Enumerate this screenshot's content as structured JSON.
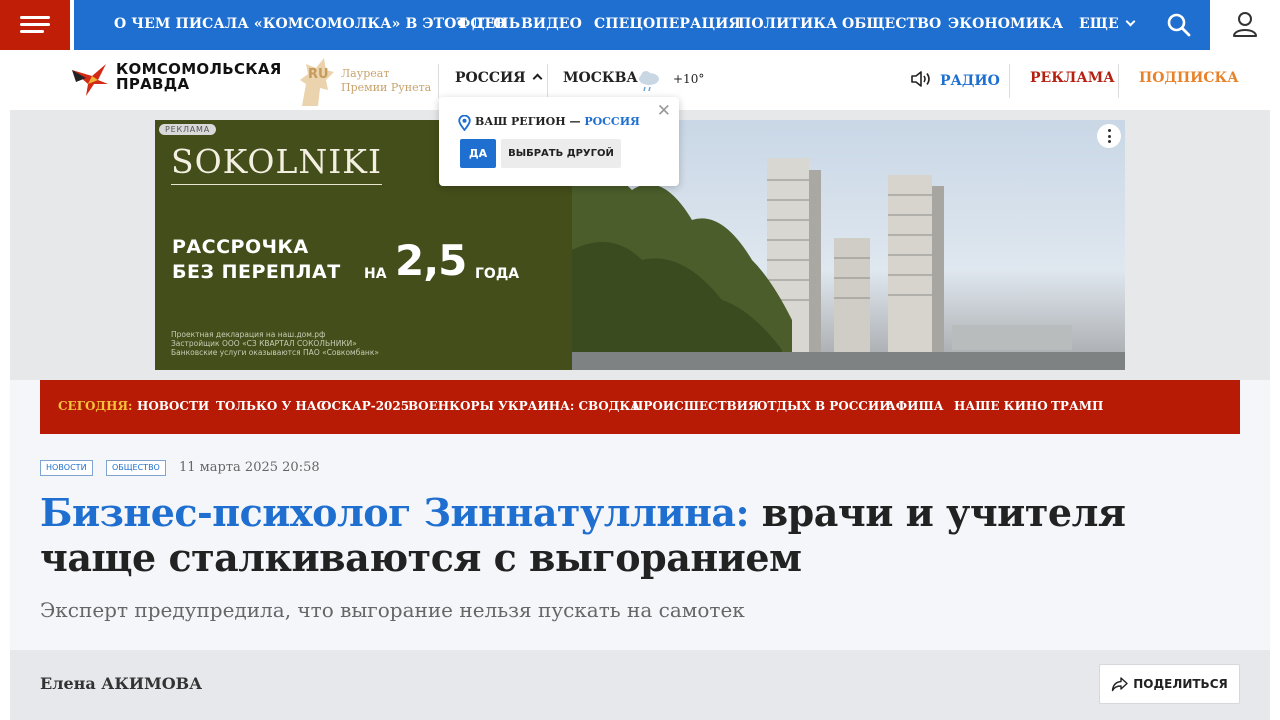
{
  "topnav": {
    "items": [
      "О ЧЕМ ПИСАЛА «КОМСОМОЛКА» В ЭТОТ ДЕНЬ",
      "ФОТО",
      "ВИДЕО",
      "СПЕЦОПЕРАЦИЯ",
      "ПОЛИТИКА",
      "ОБЩЕСТВО",
      "ЭКОНОМИКА"
    ],
    "more_label": "ЕЩЕ",
    "colors": {
      "nav_blue": "#1f6fd1",
      "menu_red": "#c11e07"
    },
    "icons": [
      "hamburger-menu-icon",
      "search-icon",
      "user-icon"
    ]
  },
  "header": {
    "logo_line1": "КОМСОМОЛЬСКАЯ",
    "logo_line2": "ПРАВДА",
    "award_line1": "Лауреат",
    "award_line2": "Премии Рунета",
    "region": "РОССИЯ",
    "city": "МОСКВА",
    "temperature": "+10°",
    "radio": "РАДИО",
    "ads": "РЕКЛАМА",
    "subscribe": "ПОДПИСКА"
  },
  "banner": {
    "badge": "РЕКЛАМА",
    "brand": "SOKOLNIKI",
    "line1": "РАССРОЧКА",
    "line2": "БЕЗ ПЕРЕПЛАТ",
    "na": "НА",
    "big": "2,5",
    "god": "ГОДА",
    "disclaimer1": "Проектная декларация на наш.дом.рф",
    "disclaimer2": "Застройщик ООО «СЗ КВАРТАЛ СОКОЛЬНИКИ»",
    "disclaimer3": "Банковские услуги оказываются ПАО «Совкомбанк»"
  },
  "region_popup": {
    "label": "ВАШ РЕГИОН —",
    "region": "РОССИЯ",
    "yes": "ДА",
    "other": "ВЫБРАТЬ ДРУГОЙ"
  },
  "today_bar": {
    "label": "СЕГОДНЯ:",
    "items": [
      "НОВОСТИ",
      "ТОЛЬКО У НАС",
      "ОСКАР-2025",
      "ВОЕНКОРЫ",
      "УКРАИНА: СВОДКА",
      "ПРОИСШЕСТВИЯ",
      "ОТДЫХ В РОССИИ",
      "АФИША",
      "НАШЕ КИНО",
      "ТРАМП"
    ]
  },
  "article": {
    "tags": [
      "НОВОСТИ",
      "ОБЩЕСТВО"
    ],
    "date": "11 марта 2025 20:58",
    "title_highlight": "Бизнес-психолог Зиннатуллина:",
    "title_rest": "врачи и учителя чаще сталкиваются с выгоранием",
    "subtitle": "Эксперт предупредила, что выгорание нельзя пускать на самотек",
    "author": "Елена АКИМОВА",
    "share": "ПОДЕЛИТЬСЯ"
  }
}
